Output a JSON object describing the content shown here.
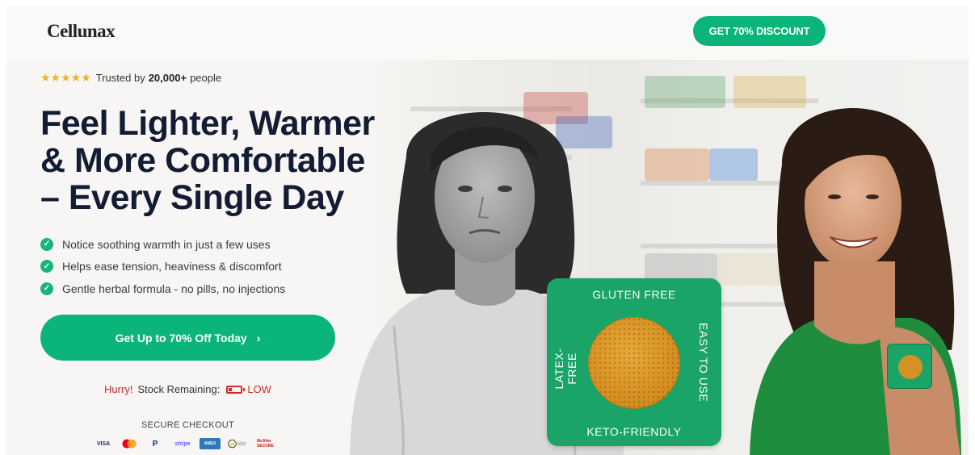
{
  "header": {
    "logo": "Cellunax",
    "discount_button": "GET 70% DISCOUNT"
  },
  "hero": {
    "trust_text": "Trusted by",
    "trust_count": "20,000+",
    "trust_suffix": "people",
    "rating_stars": 5,
    "headline_line1": "Feel Lighter, Warmer",
    "headline_line2": "& More Comfortable",
    "headline_line3": "– Every Single Day",
    "bullets": [
      "Notice soothing warmth in just a few uses",
      "Helps ease tension, heaviness & discomfort",
      "Gentle herbal formula - no pills, no injections"
    ],
    "cta_label": "Get Up to 70% Off Today",
    "stock": {
      "hurry": "Hurry!",
      "label": "Stock Remaining:",
      "level": "LOW"
    },
    "secure_checkout": "SECURE CHECKOUT",
    "payments": [
      "VISA",
      "mastercard",
      "PayPal",
      "stripe",
      "AMEX",
      "Norton",
      "McAfee SECURE"
    ]
  },
  "product_card": {
    "top": "GLUTEN FREE",
    "bottom": "KETO-FRIENDLY",
    "left": "LATEX-FREE",
    "right": "EASY TO USE"
  },
  "colors": {
    "brand_green": "#0bb57a",
    "headline": "#131c33",
    "alert_red": "#d62828",
    "star": "#f4b223"
  }
}
